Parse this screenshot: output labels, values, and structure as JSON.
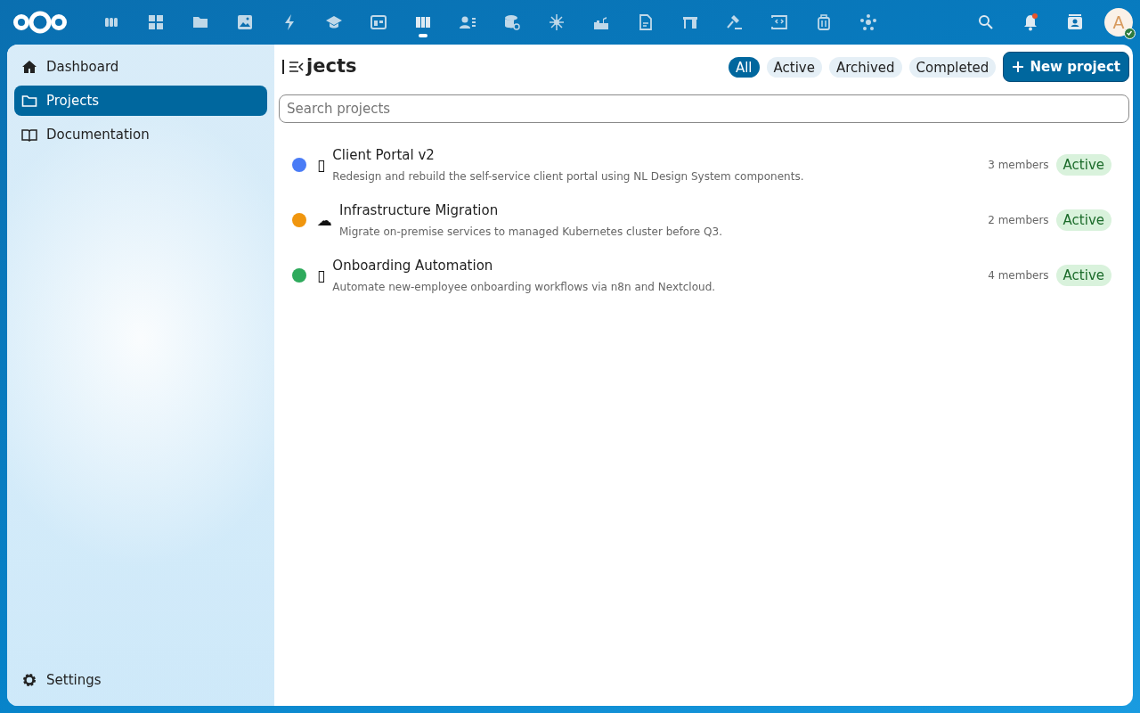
{
  "header": {
    "apps": [
      {
        "selected": false
      },
      {
        "selected": false
      },
      {
        "selected": false
      },
      {
        "selected": false
      },
      {
        "selected": false
      },
      {
        "selected": false
      },
      {
        "selected": false
      },
      {
        "selected": true
      },
      {
        "selected": false
      },
      {
        "selected": false
      },
      {
        "selected": false
      },
      {
        "selected": false
      },
      {
        "selected": false
      },
      {
        "selected": false
      },
      {
        "selected": false
      },
      {
        "selected": false
      },
      {
        "selected": false
      },
      {
        "selected": false
      }
    ],
    "notifications_unread": true,
    "avatar": {
      "initial": "A",
      "online": true
    }
  },
  "sidebar": {
    "items": [
      {
        "label": "Dashboard",
        "kind": "home",
        "selected": false
      },
      {
        "label": "Projects",
        "kind": "folder",
        "selected": true
      },
      {
        "label": "Documentation",
        "kind": "book",
        "selected": false
      }
    ],
    "settings": "Settings"
  },
  "main": {
    "title": "jects",
    "filters": [
      {
        "label": "All",
        "selected": true
      },
      {
        "label": "Active",
        "selected": false
      },
      {
        "label": "Archived",
        "selected": false
      },
      {
        "label": "Completed",
        "selected": false
      }
    ],
    "new_button": "New project",
    "search": {
      "placeholder": "Search projects"
    },
    "projects": [
      {
        "color": "#4a7cf6",
        "icon": "▯",
        "name": "Client Portal v2",
        "description": "Redesign and rebuild the self-service client portal using NL Design System components.",
        "members": "3 members",
        "status": "Active"
      },
      {
        "color": "#f0960e",
        "icon": "☁",
        "name": "Infrastructure Migration",
        "description": "Migrate on-premise services to managed Kubernetes cluster before Q3.",
        "members": "2 members",
        "status": "Active"
      },
      {
        "color": "#2eaa5c",
        "icon": "▯",
        "name": "Onboarding Automation",
        "description": "Automate new-employee onboarding workflows via n8n and Nextcloud.",
        "members": "4 members",
        "status": "Active"
      }
    ]
  }
}
